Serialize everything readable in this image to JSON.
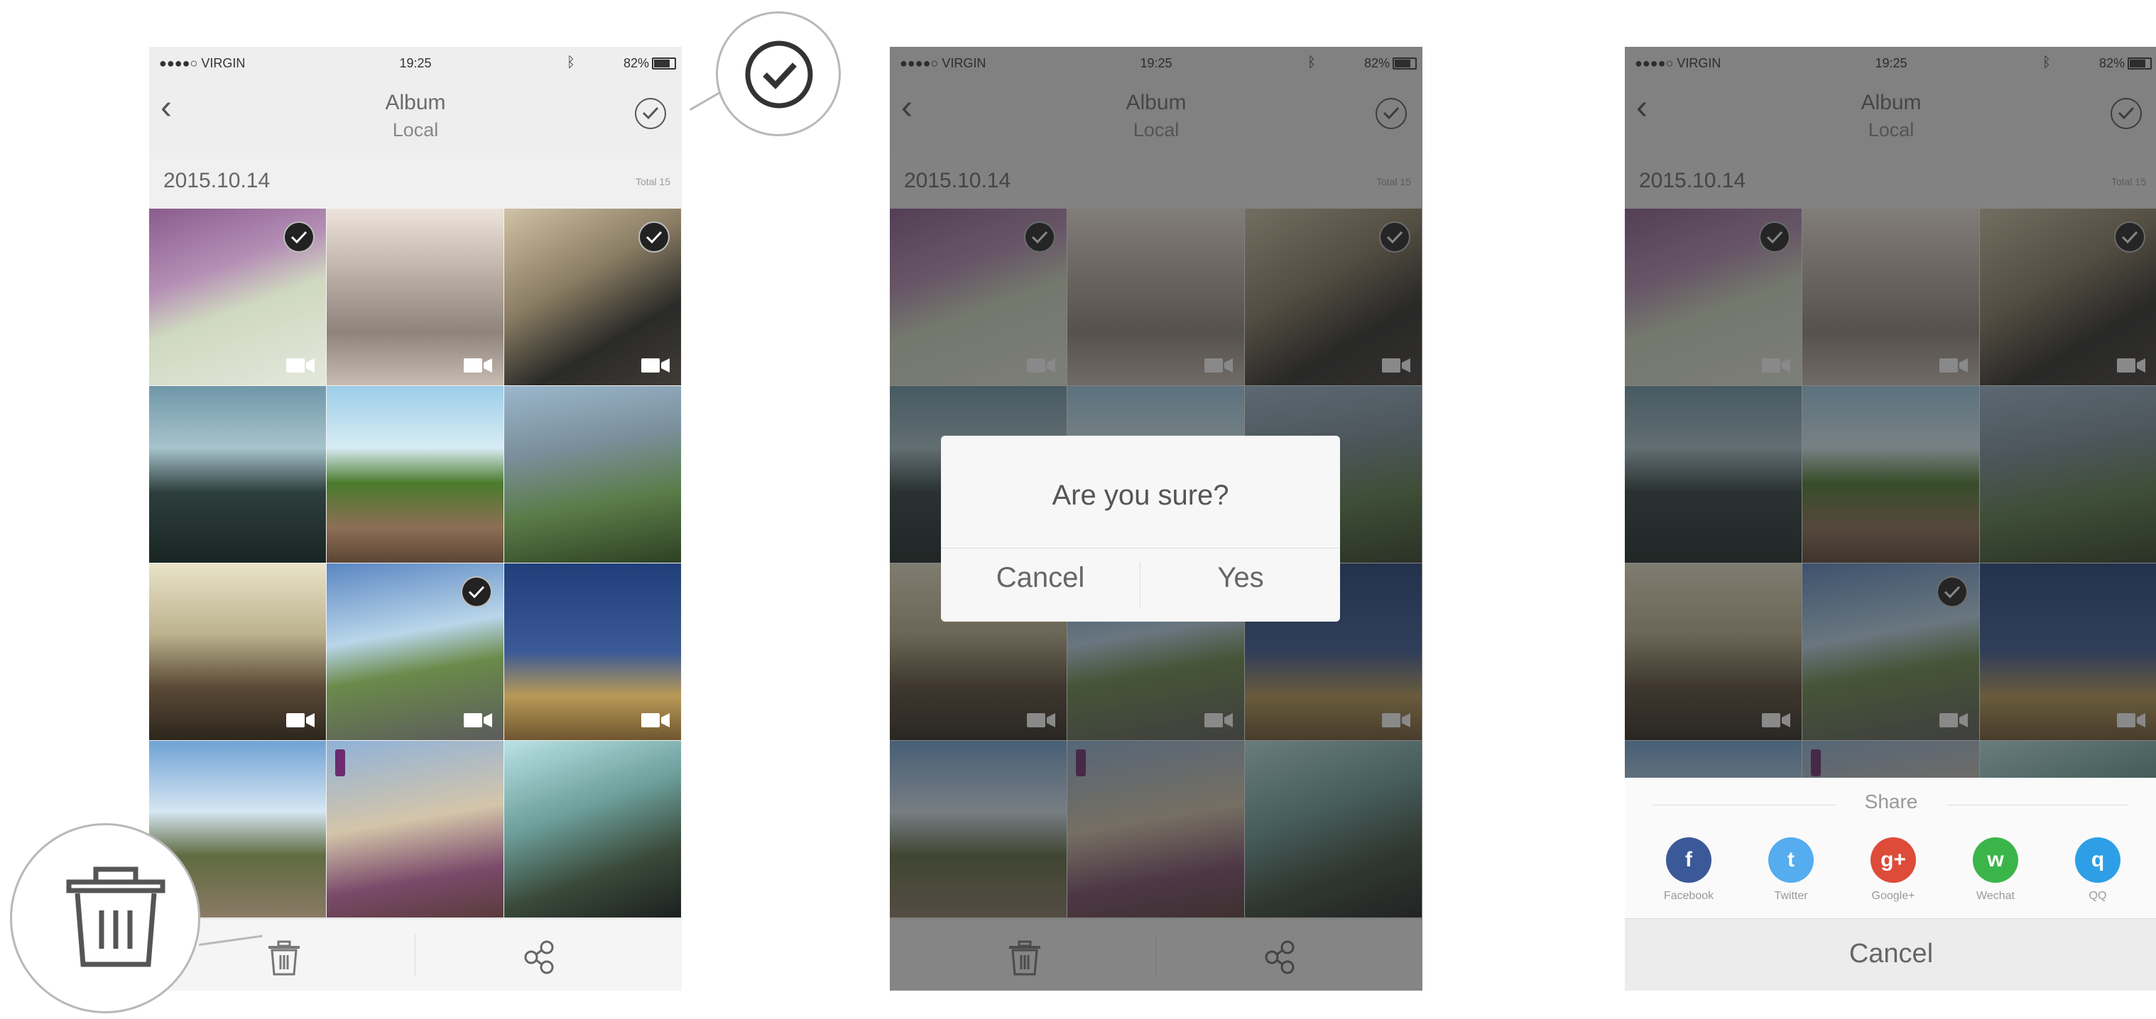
{
  "statusbar": {
    "carrier": "●●●●○ VIRGIN",
    "time": "19:25",
    "battery": "82%"
  },
  "navbar": {
    "title": "Album",
    "subtitle": "Local"
  },
  "album": {
    "date": "2015.10.14",
    "total": "Total 15"
  },
  "dialog": {
    "message": "Are you sure?",
    "cancel_label": "Cancel",
    "yes_label": "Yes"
  },
  "share": {
    "title": "Share",
    "items": [
      {
        "label": "Facebook",
        "glyph": "f",
        "color": "#3b5998"
      },
      {
        "label": "Twitter",
        "glyph": "t",
        "color": "#55acee"
      },
      {
        "label": "Google+",
        "glyph": "g+",
        "color": "#dd4b39"
      },
      {
        "label": "Wechat",
        "glyph": "w",
        "color": "#3bb54a"
      },
      {
        "label": "QQ",
        "glyph": "q",
        "color": "#2e9fe6"
      }
    ],
    "cancel_label": "Cancel"
  }
}
